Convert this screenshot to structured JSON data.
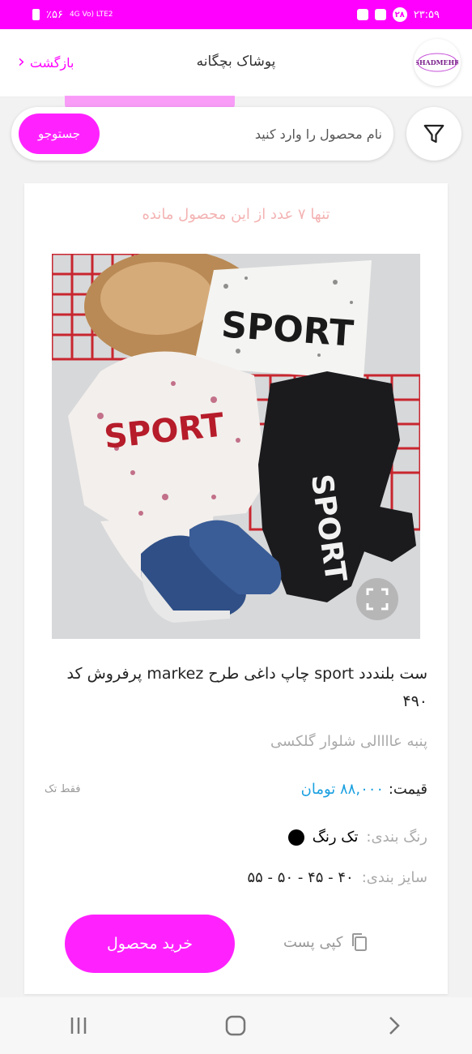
{
  "status_bar": {
    "time": "۲۳:۵۹",
    "day_chip": "۲۸",
    "battery": "٪۵۶",
    "network": "4G Vo) LTE2"
  },
  "header": {
    "title": "پوشاک بچگانه",
    "back_label": "بازگشت",
    "logo_text": "SHADMEHR"
  },
  "search": {
    "placeholder": "نام محصول را وارد کنید",
    "button_label": "جستوجو"
  },
  "product": {
    "stock_notice": "تنها ۷ عدد از این محصول مانده",
    "title": "ست بلنددد sport چاپ داغی طرح markez پرفروش کد ۴۹۰",
    "subtitle": "پنبه عاااالی شلوار گلکسی",
    "price_label": "قیمت:",
    "price_value": "۸۸,۰۰۰ تومان",
    "single_only": "فقط تک",
    "color_label": "رنگ بندی:",
    "color_value": "تک رنگ",
    "size_label": "سایز بندی:",
    "size_value": "۴۰ - ۴۵ - ۵۰ - ۵۵",
    "copy_post_label": "کپی پست",
    "buy_label": "خرید محصول",
    "photo_text": "SPORT"
  },
  "colors": {
    "brand": "#ff00ff",
    "price": "#1aa0e0",
    "stock_notice": "#f4b3b3"
  }
}
